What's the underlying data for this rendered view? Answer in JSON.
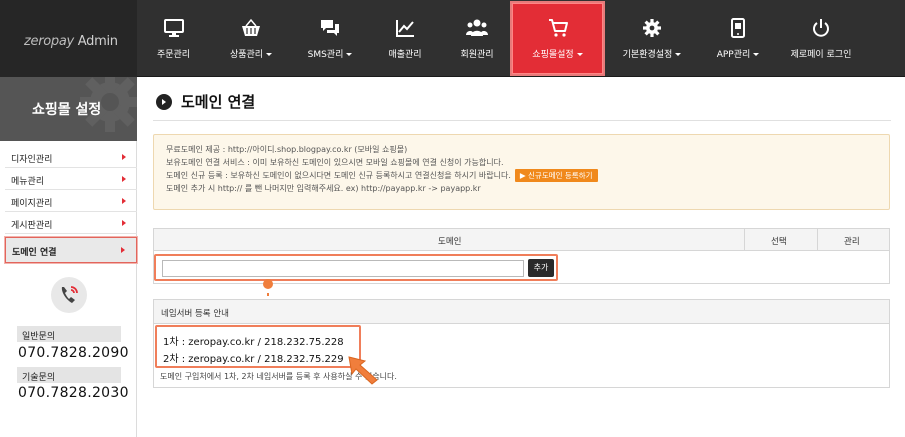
{
  "logo": {
    "zero": "zero",
    "pay": "pay",
    "admin": "Admin"
  },
  "nav": [
    {
      "label": "주문관리",
      "icon": "monitor-icon",
      "caret": false
    },
    {
      "label": "상품관리",
      "icon": "basket-icon",
      "caret": true
    },
    {
      "label": "SMS관리",
      "icon": "chat-icon",
      "caret": true
    },
    {
      "label": "매출관리",
      "icon": "line-chart-icon",
      "caret": false
    },
    {
      "label": "회원관리",
      "icon": "users-icon",
      "caret": false
    },
    {
      "label": "쇼핑몰설정",
      "icon": "cart-icon",
      "caret": true,
      "active": true
    },
    {
      "label": "기본환경설정",
      "icon": "gear-icon",
      "caret": true
    },
    {
      "label": "APP관리",
      "icon": "tablet-icon",
      "caret": true
    },
    {
      "label": "제로페이 로그인",
      "icon": "power-icon",
      "caret": false
    }
  ],
  "sidebar": {
    "title": "쇼핑몰 설정",
    "items": [
      {
        "label": "디자인관리"
      },
      {
        "label": "메뉴관리"
      },
      {
        "label": "페이지관리"
      },
      {
        "label": "게시판관리"
      },
      {
        "label": "도메인 연결",
        "active": true
      }
    ],
    "contacts": [
      {
        "label": "일반문의",
        "number": "070.7828.2090"
      },
      {
        "label": "기술문의",
        "number": "070.7828.2030"
      }
    ]
  },
  "main": {
    "title": "도메인 연결",
    "notice": {
      "line1": "무료도메인 제공 : http://아이디.shop.blogpay.co.kr (모바일 쇼핑몰)",
      "line2": "보유도메인 연결 서비스 : 이미 보유하신 도메인이 있으시면 모바일 쇼핑몰에 연결 신청이 가능합니다.",
      "line3": "도메인 신규 등록 : 보유하신 도메인이 없으시다면 도메인 신규 등록하시고 연결신청을 하시기 바랍니다.",
      "register_button": "▶ 신규도메인 등록하기",
      "line4": "도메인 추가 시 http:// 를 뺀 나머지만 입력해주세요. ex) http://payapp.kr -> payapp.kr"
    },
    "domain_table": {
      "headers": {
        "domain": "도메인",
        "select": "선택",
        "manage": "관리"
      },
      "input_value": "",
      "add_button": "추가"
    },
    "nameserver": {
      "title": "네임서버 등록 안내",
      "line1": "1차 :  zeropay.co.kr  / 218.232.75.228",
      "line2": "2차 :  zeropay.co.kr  / 218.232.75.229",
      "footer": "도메인 구입처에서 1차, 2차 네임서버를 등록 후 사용하실 수 있습니다."
    }
  },
  "colors": {
    "accent": "#e32d36",
    "highlight": "#f07e5a",
    "notice_bg": "#fdf7ea"
  }
}
